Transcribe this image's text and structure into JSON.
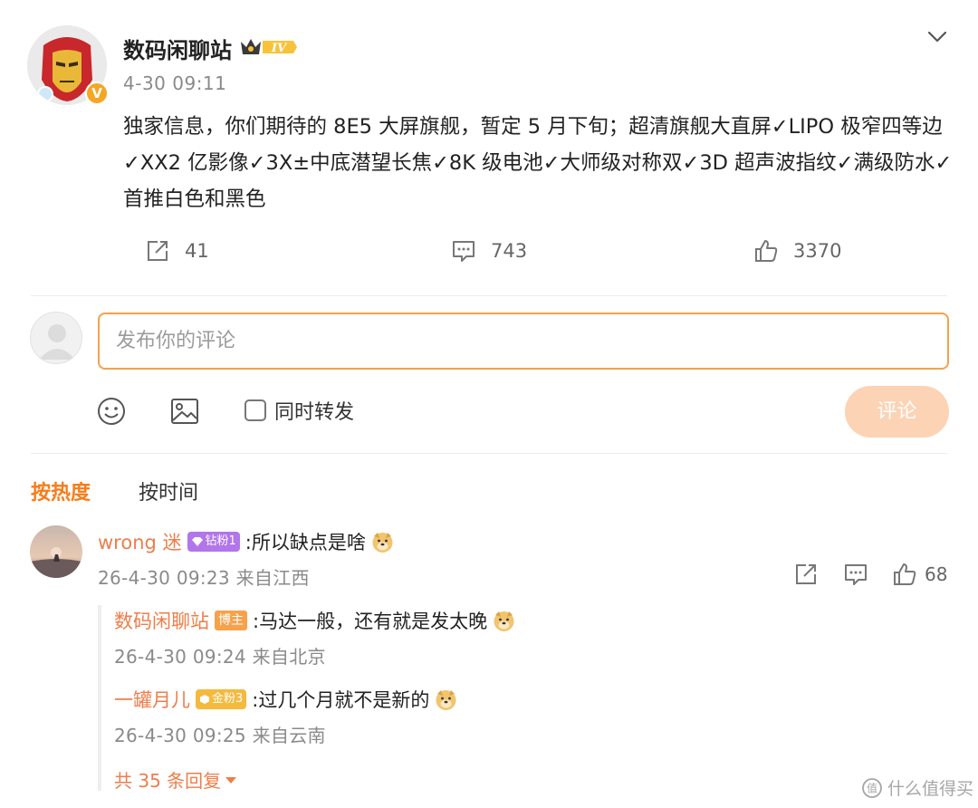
{
  "post": {
    "author": "数码闲聊站",
    "level": "IV",
    "verified_mark": "V",
    "time": "4-30 09:11",
    "body": "独家信息，你们期待的 8E5 大屏旗舰，暂定 5 月下旬；超清旗舰大直屏✓LIPO 极窄四等边✓XX2 亿影像✓3X±中底潜望长焦✓8K 级电池✓大师级对称双✓3D 超声波指纹✓满级防水✓首推白色和黑色",
    "actions": {
      "repost_count": "41",
      "comment_count": "743",
      "like_count": "3370"
    },
    "icons": [
      "iron-man-avatar",
      "verified-v-icon",
      "crown-level-icon",
      "chevron-down-icon",
      "repost-icon",
      "comment-icon",
      "like-icon"
    ]
  },
  "composer": {
    "placeholder": "发布你的评论",
    "repost_label": "同时转发",
    "submit_label": "评论",
    "icons": [
      "emoji-icon",
      "image-icon"
    ]
  },
  "sort": {
    "hot": "按热度",
    "time": "按时间"
  },
  "comments": [
    {
      "name": "wrong 迷",
      "badge": "钻粉1",
      "text": ":所以缺点是啥",
      "meta": "26-4-30 09:23 来自江西",
      "like_count": "68",
      "replies": [
        {
          "name": "数码闲聊站",
          "badge": "博主",
          "text": ":马达一般，还有就是发太晚",
          "meta": "26-4-30 09:24 来自北京"
        },
        {
          "name": "一罐月儿",
          "badge": "金粉3",
          "text": ":过几个月就不是新的",
          "meta": "26-4-30 09:25 来自云南"
        }
      ],
      "more_replies": "共 35 条回复"
    }
  ],
  "watermark": "什么值得买",
  "colors": {
    "accent": "#f77c1a",
    "name": "#ef7d4b",
    "input_border": "#f7a14b",
    "submit_bg": "#fcd3b4",
    "diamond_badge": "#b275ea",
    "gold_badge": "#f5b93d"
  }
}
